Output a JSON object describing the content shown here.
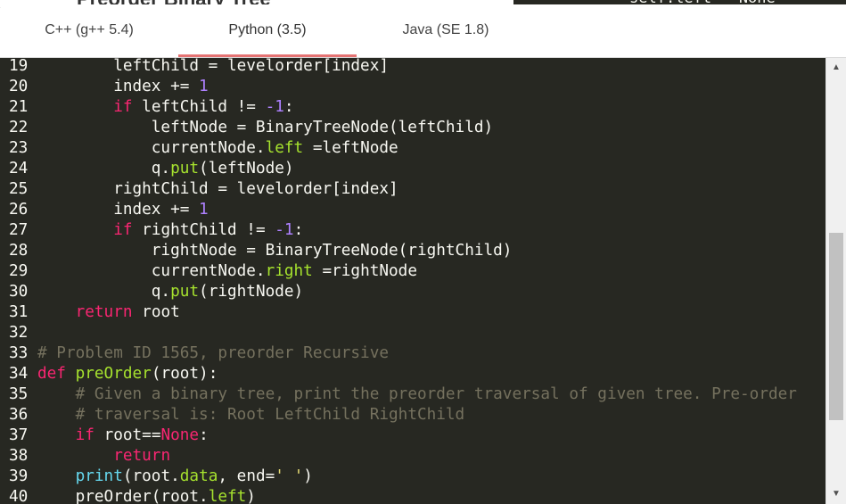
{
  "background": {
    "heading": "Preorder Binary Tree",
    "code_snippet": "self.left = None"
  },
  "tabs": [
    {
      "label": "C++ (g++ 5.4)",
      "active": false
    },
    {
      "label": "Python (3.5)",
      "active": true
    },
    {
      "label": "Java (SE 1.8)",
      "active": false
    }
  ],
  "theme": {
    "accent": "#e57373",
    "editor_bg": "#272822",
    "keyword": "#f92672",
    "number": "#ae81ff",
    "attribute": "#a6e22e",
    "comment": "#75715e",
    "string": "#e6db74",
    "builtin": "#66d9ef"
  },
  "editor": {
    "lines": [
      {
        "n": "19",
        "tokens": [
          {
            "t": "        leftChild = levelorder[index]",
            "c": ""
          }
        ]
      },
      {
        "n": "20",
        "tokens": [
          {
            "t": "        index += ",
            "c": ""
          },
          {
            "t": "1",
            "c": "num"
          }
        ]
      },
      {
        "n": "21",
        "tokens": [
          {
            "t": "        ",
            "c": ""
          },
          {
            "t": "if",
            "c": "kw"
          },
          {
            "t": " leftChild != ",
            "c": ""
          },
          {
            "t": "-1",
            "c": "num"
          },
          {
            "t": ":",
            "c": ""
          }
        ]
      },
      {
        "n": "22",
        "tokens": [
          {
            "t": "            leftNode = BinaryTreeNode(leftChild)",
            "c": ""
          }
        ]
      },
      {
        "n": "23",
        "tokens": [
          {
            "t": "            currentNode.",
            "c": ""
          },
          {
            "t": "left",
            "c": "attr"
          },
          {
            "t": " =leftNode",
            "c": ""
          }
        ]
      },
      {
        "n": "24",
        "tokens": [
          {
            "t": "            q.",
            "c": ""
          },
          {
            "t": "put",
            "c": "attr"
          },
          {
            "t": "(leftNode)",
            "c": ""
          }
        ]
      },
      {
        "n": "25",
        "tokens": [
          {
            "t": "        rightChild = levelorder[index]",
            "c": ""
          }
        ]
      },
      {
        "n": "26",
        "tokens": [
          {
            "t": "        index += ",
            "c": ""
          },
          {
            "t": "1",
            "c": "num"
          }
        ]
      },
      {
        "n": "27",
        "tokens": [
          {
            "t": "        ",
            "c": ""
          },
          {
            "t": "if",
            "c": "kw"
          },
          {
            "t": " rightChild != ",
            "c": ""
          },
          {
            "t": "-1",
            "c": "num"
          },
          {
            "t": ":",
            "c": ""
          }
        ]
      },
      {
        "n": "28",
        "tokens": [
          {
            "t": "            rightNode = BinaryTreeNode(rightChild)",
            "c": ""
          }
        ]
      },
      {
        "n": "29",
        "tokens": [
          {
            "t": "            currentNode.",
            "c": ""
          },
          {
            "t": "right",
            "c": "attr"
          },
          {
            "t": " =rightNode",
            "c": ""
          }
        ]
      },
      {
        "n": "30",
        "tokens": [
          {
            "t": "            q.",
            "c": ""
          },
          {
            "t": "put",
            "c": "attr"
          },
          {
            "t": "(rightNode)",
            "c": ""
          }
        ]
      },
      {
        "n": "31",
        "tokens": [
          {
            "t": "    ",
            "c": ""
          },
          {
            "t": "return",
            "c": "kw"
          },
          {
            "t": " root",
            "c": ""
          }
        ]
      },
      {
        "n": "32",
        "tokens": []
      },
      {
        "n": "33",
        "tokens": [
          {
            "t": "# Problem ID 1565, preorder Recursive",
            "c": "cm"
          }
        ]
      },
      {
        "n": "34",
        "tokens": [
          {
            "t": "def",
            "c": "kw"
          },
          {
            "t": " ",
            "c": ""
          },
          {
            "t": "preOrder",
            "c": "attr"
          },
          {
            "t": "(root):",
            "c": ""
          }
        ]
      },
      {
        "n": "35",
        "tokens": [
          {
            "t": "    ",
            "c": ""
          },
          {
            "t": "# Given a binary tree, print the preorder traversal of given tree. Pre-order",
            "c": "cm"
          }
        ]
      },
      {
        "n": "36",
        "tokens": [
          {
            "t": "    ",
            "c": ""
          },
          {
            "t": "# traversal is: Root LeftChild RightChild",
            "c": "cm"
          }
        ]
      },
      {
        "n": "37",
        "tokens": [
          {
            "t": "    ",
            "c": ""
          },
          {
            "t": "if",
            "c": "kw"
          },
          {
            "t": " root==",
            "c": ""
          },
          {
            "t": "None",
            "c": "kw"
          },
          {
            "t": ":",
            "c": ""
          }
        ]
      },
      {
        "n": "38",
        "tokens": [
          {
            "t": "        ",
            "c": ""
          },
          {
            "t": "return",
            "c": "kw"
          }
        ]
      },
      {
        "n": "39",
        "tokens": [
          {
            "t": "    ",
            "c": ""
          },
          {
            "t": "print",
            "c": "fn"
          },
          {
            "t": "(root.",
            "c": ""
          },
          {
            "t": "data",
            "c": "attr"
          },
          {
            "t": ", end=",
            "c": ""
          },
          {
            "t": "' '",
            "c": "str"
          },
          {
            "t": ")",
            "c": ""
          }
        ]
      },
      {
        "n": "40",
        "tokens": [
          {
            "t": "    preOrder(root.",
            "c": ""
          },
          {
            "t": "left",
            "c": "attr"
          },
          {
            "t": ")",
            "c": ""
          }
        ]
      }
    ]
  },
  "scrollbar": {
    "up_icon": "triangle-up",
    "down_icon": "triangle-down",
    "position": 0.48
  }
}
